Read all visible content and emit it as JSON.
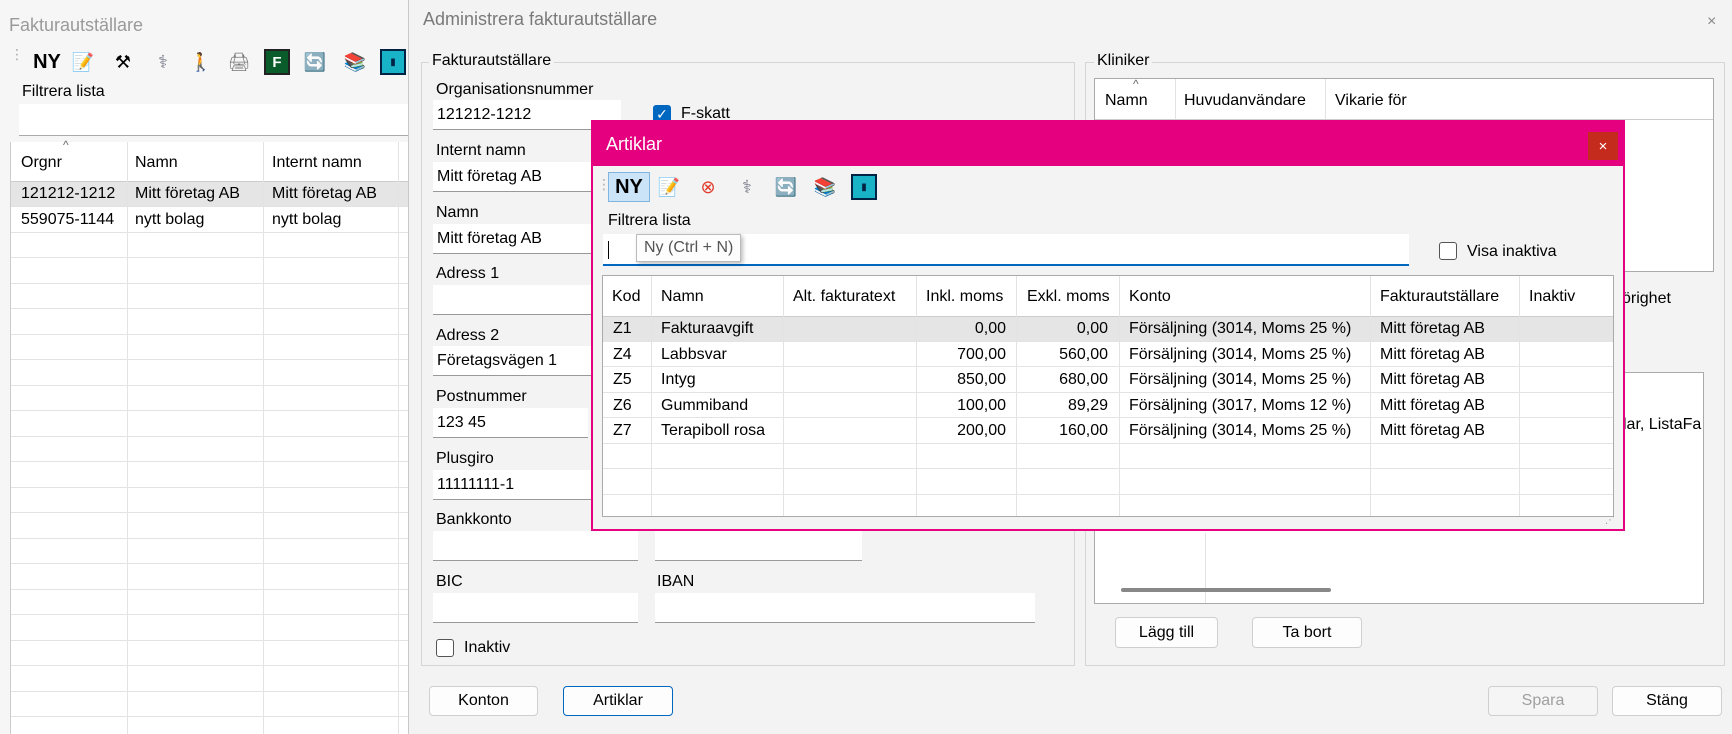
{
  "background_window": {
    "title": "Fakturautställare",
    "toolbar_new": "NY",
    "filter_label": "Filtrera lista",
    "columns": [
      "Orgnr",
      "Namn",
      "Internt namn"
    ],
    "rows": [
      [
        "121212-1212",
        "Mitt företag AB",
        "Mitt företag AB"
      ],
      [
        "559075-1144",
        "nytt bolag",
        "nytt bolag"
      ]
    ]
  },
  "main_dialog": {
    "title": "Administrera fakturautställare",
    "close": "×",
    "group_title": "Fakturautställare",
    "fields": {
      "org_label": "Organisationsnummer",
      "org_value": "121212-1212",
      "fskatt_label": "F-skatt",
      "internt_label": "Internt namn",
      "internt_value": "Mitt företag AB",
      "namn_label": "Namn",
      "namn_value": "Mitt företag AB",
      "adress1_label": "Adress 1",
      "adress1_value": "",
      "adress2_label": "Adress 2",
      "adress2_value": "Företagsvägen 1",
      "postnr_label": "Postnummer",
      "postnr_value": "123 45",
      "plusgiro_label": "Plusgiro",
      "plusgiro_value": "11111111-1",
      "bankkonto_label": "Bankkonto",
      "bankkonto_value": "",
      "bic_label": "BIC",
      "bic_value": "",
      "iban_label": "IBAN",
      "iban_value": "",
      "inaktiv_label": "Inaktiv"
    },
    "kliniker": {
      "title": "Kliniker",
      "columns": [
        "Namn",
        "Huvudanvändare",
        "Vikarie för"
      ],
      "partial_text_1": "örighet",
      "partial_text_2": "lar, ListaFa"
    },
    "buttons": {
      "lagg_till": "Lägg till",
      "ta_bort": "Ta bort",
      "konton": "Konton",
      "artiklar": "Artiklar",
      "spara": "Spara",
      "stang": "Stäng"
    }
  },
  "artiklar_dialog": {
    "title": "Artiklar",
    "close": "×",
    "toolbar_new": "NY",
    "filter_label": "Filtrera lista",
    "filter_value": "",
    "tooltip": "Ny (Ctrl + N)",
    "visa_inaktiva_label": "Visa inaktiva",
    "columns": [
      "Kod",
      "Namn",
      "Alt. fakturatext",
      "Inkl. moms",
      "Exkl. moms",
      "Konto",
      "Fakturautställare",
      "Inaktiv"
    ],
    "rows": [
      [
        "Z1",
        "Fakturaavgift",
        "",
        "0,00",
        "0,00",
        "Försäljning (3014, Moms 25 %)",
        "Mitt företag AB",
        ""
      ],
      [
        "Z4",
        "Labbsvar",
        "",
        "700,00",
        "560,00",
        "Försäljning (3014, Moms 25 %)",
        "Mitt företag AB",
        ""
      ],
      [
        "Z5",
        "Intyg",
        "",
        "850,00",
        "680,00",
        "Försäljning (3014, Moms 25 %)",
        "Mitt företag AB",
        ""
      ],
      [
        "Z6",
        "Gummiband",
        "",
        "100,00",
        "89,29",
        "Försäljning (3017, Moms 12 %)",
        "Mitt företag AB",
        ""
      ],
      [
        "Z7",
        "Terapiboll rosa",
        "",
        "200,00",
        "160,00",
        "Försäljning (3014, Moms 25 %)",
        "Mitt företag AB",
        ""
      ]
    ]
  },
  "colors": {
    "accent": "#e4007f",
    "primary": "#0067c0",
    "close_red": "#c42b1c"
  }
}
